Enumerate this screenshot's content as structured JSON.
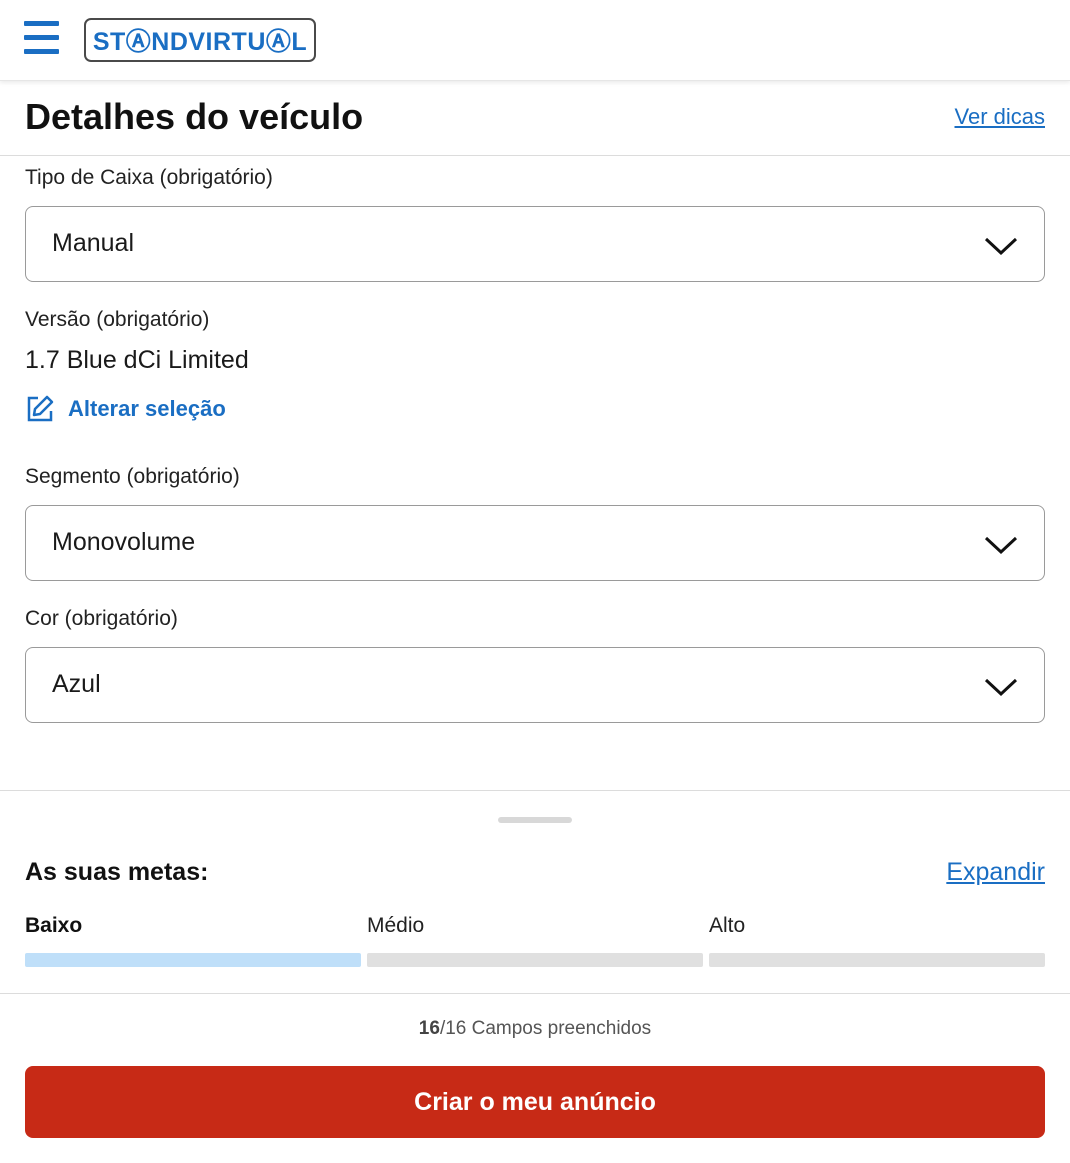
{
  "app": {
    "logo_text": "STⒶNDVIRTUⒶL",
    "brand_color": "#1a6ec3",
    "cta_color": "#c72a16"
  },
  "header": {
    "title": "Detalhes do veículo",
    "tips_link": "Ver dicas"
  },
  "form": {
    "gearbox": {
      "label": "Tipo de Caixa (obrigatório)",
      "value": "Manual",
      "icon": "chevron-down-icon"
    },
    "version": {
      "label": "Versão (obrigatório)",
      "value": "1.7 Blue dCi Limited",
      "change_label": "Alterar seleção",
      "change_icon": "edit-icon"
    },
    "segment": {
      "label": "Segmento (obrigatório)",
      "value": "Monovolume",
      "icon": "chevron-down-icon"
    },
    "color": {
      "label": "Cor (obrigatório)",
      "value": "Azul",
      "icon": "chevron-down-icon"
    }
  },
  "goals": {
    "title": "As suas metas:",
    "expand_label": "Expandir",
    "levels": [
      {
        "label": "Baixo",
        "active": true,
        "color": "#bfdff9"
      },
      {
        "label": "Médio",
        "active": false,
        "color": "#e0e0e0"
      },
      {
        "label": "Alto",
        "active": false,
        "color": "#e0e0e0"
      }
    ]
  },
  "footer": {
    "filled": "16",
    "total_text": "/16 Campos preenchidos",
    "cta_label": "Criar o meu anúncio"
  }
}
